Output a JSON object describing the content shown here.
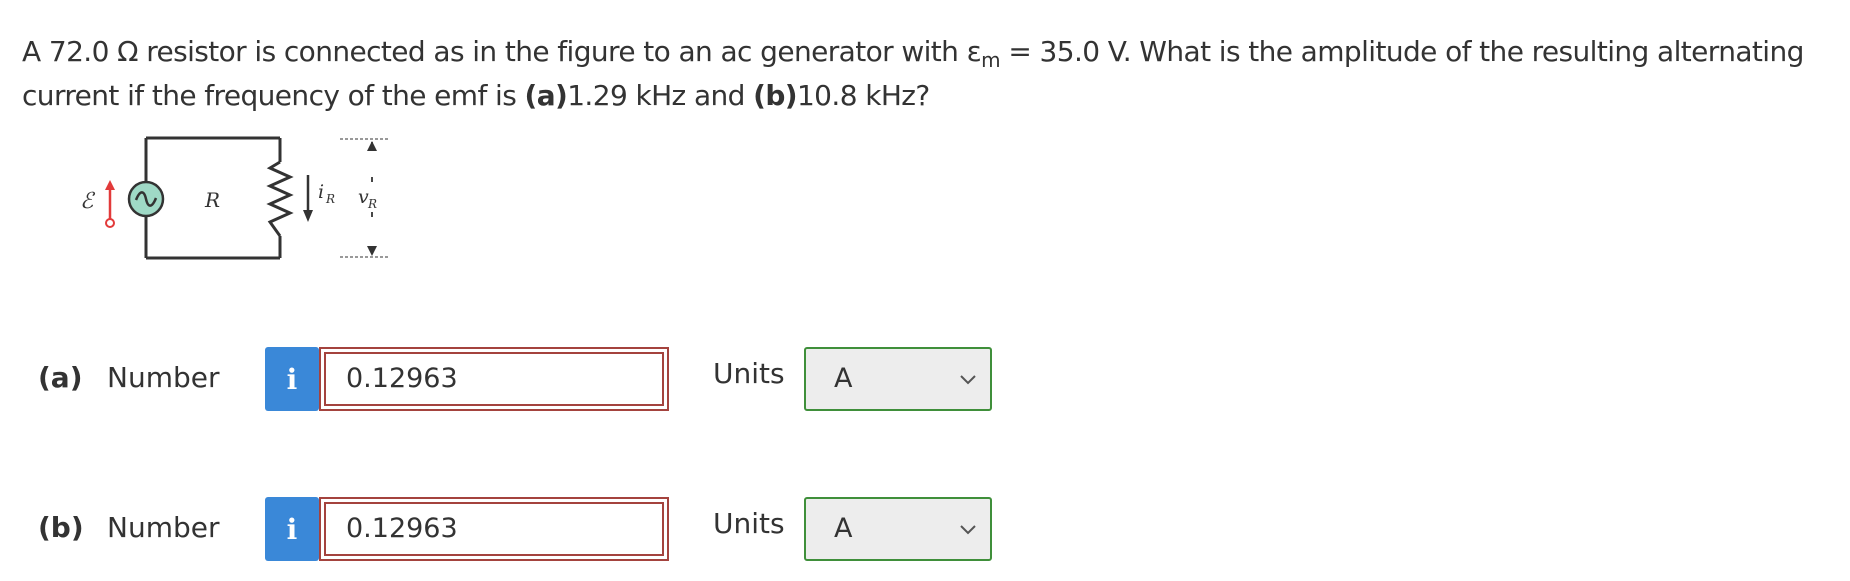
{
  "question": {
    "part1": "A 72.0 Ω resistor is connected as in the figure to an ac generator with ε",
    "sub": "m",
    "part2": " = 35.0 V. What is the amplitude of the resulting alternating current if the frequency of the emf is ",
    "a_label": "(a)",
    "a_value": "1.29 kHz",
    "and": " and ",
    "b_label": "(b)",
    "b_value": "10.8 kHz?"
  },
  "figure": {
    "emf_symbol": "ℰ",
    "resistor_label": "R",
    "current_label": "i",
    "current_sub": "R",
    "voltage_label": "v",
    "voltage_sub": "R",
    "colors": {
      "wire": "#333333",
      "generator_fill": "#9fd9c6",
      "emf_arrow": "#e23a3a"
    }
  },
  "rows": [
    {
      "part": "(a)",
      "label": "Number",
      "info_icon": "i",
      "value": "0.12963",
      "units_label": "Units",
      "units_value": "A"
    },
    {
      "part": "(b)",
      "label": "Number",
      "info_icon": "i",
      "value": "0.12963",
      "units_label": "Units",
      "units_value": "A"
    }
  ],
  "colors": {
    "info_button": "#3a88d8",
    "answer_border": "#a4433e",
    "units_border": "#3f8f3a",
    "units_bg": "#ededed"
  }
}
